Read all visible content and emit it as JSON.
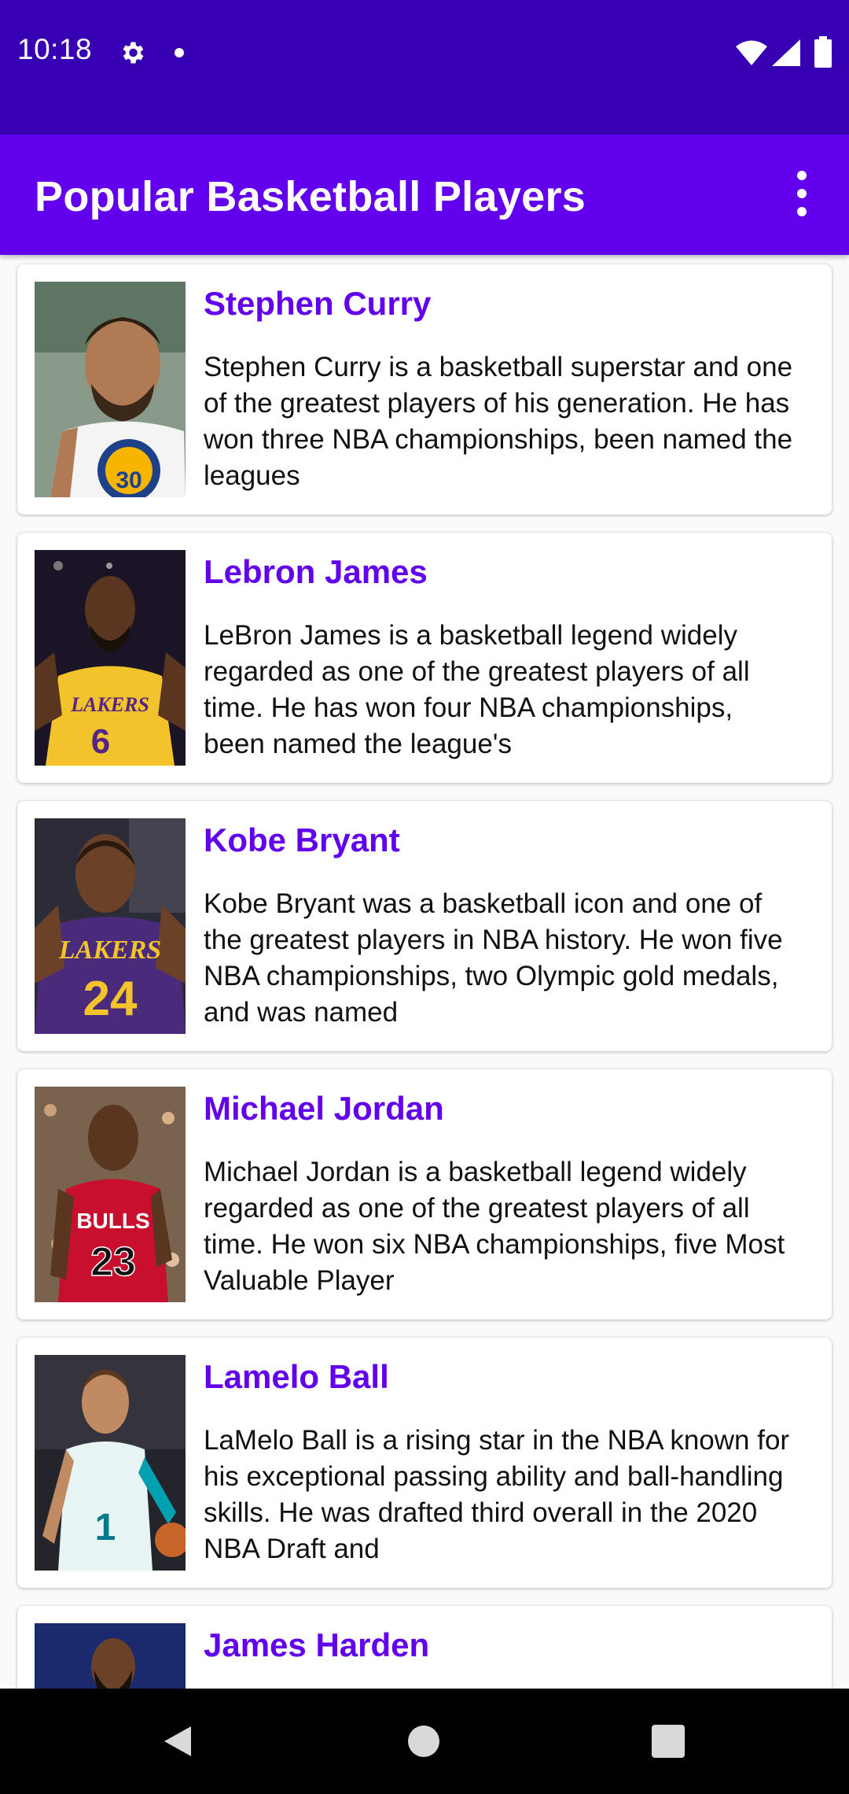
{
  "status_bar": {
    "time": "10:18",
    "icons": [
      "gear-icon",
      "notification-dot-icon",
      "wifi-icon",
      "signal-icon",
      "battery-icon"
    ]
  },
  "app_bar": {
    "title": "Popular Basketball Players",
    "menu_icon": "more-vert-icon"
  },
  "colors": {
    "status_bar": "#3700b3",
    "app_bar": "#6200ee",
    "accent_text": "#6200ee"
  },
  "players": [
    {
      "name": "Stephen Curry",
      "description": "Stephen Curry is a basketball superstar and one of the greatest players of his generation. He has won three NBA championships, been named the leagues",
      "photo_icon": "player-photo-curry"
    },
    {
      "name": "Lebron James",
      "description": "LeBron James is a basketball legend widely regarded as one of the greatest players of all time. He has won four NBA championships, been named the league's",
      "photo_icon": "player-photo-lebron"
    },
    {
      "name": "Kobe Bryant",
      "description": "Kobe Bryant was a basketball icon and one of the greatest players in NBA history. He won five NBA championships, two Olympic gold medals, and was named",
      "photo_icon": "player-photo-kobe"
    },
    {
      "name": "Michael Jordan",
      "description": "Michael Jordan is a basketball legend widely regarded as one of the greatest players of all time. He won six NBA championships, five Most Valuable Player",
      "photo_icon": "player-photo-jordan"
    },
    {
      "name": "Lamelo Ball",
      "description": "LaMelo Ball is a rising star in the NBA known for his exceptional passing ability and ball-handling skills. He was drafted third overall in the 2020 NBA Draft and",
      "photo_icon": "player-photo-lamelo"
    },
    {
      "name": "James Harden",
      "description": "",
      "photo_icon": "player-photo-harden"
    }
  ],
  "jersey_text": {
    "curry": "30",
    "lebron_team": "LAKERS",
    "lebron": "6",
    "kobe_team": "LAKERS",
    "kobe": "24",
    "jordan_team": "BULLS",
    "jordan": "23",
    "lamelo": "1"
  },
  "nav_bar": {
    "icons": [
      "back-icon",
      "home-icon",
      "recents-icon"
    ]
  }
}
